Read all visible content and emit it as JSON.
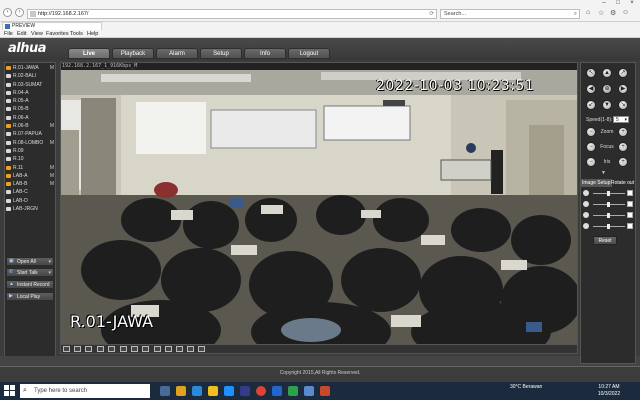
{
  "browser": {
    "url": "http://192.168.2.167/",
    "search_placeholder": "Search...",
    "tab_title": "PREVIEW",
    "menu": [
      "File",
      "Edit",
      "View",
      "Favorites",
      "Tools",
      "Help"
    ]
  },
  "app": {
    "logo": "alhua",
    "nav_tabs": [
      "Live",
      "Playback",
      "Alarm",
      "Setup",
      "Info",
      "Logout"
    ],
    "active_tab": "Live"
  },
  "channels": [
    {
      "label": "R.01-JAWA",
      "active": true,
      "mark": "M"
    },
    {
      "label": "R.02-BALI",
      "active": false,
      "mark": ""
    },
    {
      "label": "R.03-SUMAT",
      "active": false,
      "mark": ""
    },
    {
      "label": "R.04-A",
      "active": false,
      "mark": ""
    },
    {
      "label": "R.05-A",
      "active": false,
      "mark": ""
    },
    {
      "label": "R.05-B",
      "active": false,
      "mark": ""
    },
    {
      "label": "R.06-A",
      "active": false,
      "mark": ""
    },
    {
      "label": "R.06-B",
      "active": true,
      "mark": "M"
    },
    {
      "label": "R.07-PAPUA",
      "active": false,
      "mark": ""
    },
    {
      "label": "R.08-LOMBO",
      "active": false,
      "mark": "M"
    },
    {
      "label": "R.09",
      "active": false,
      "mark": ""
    },
    {
      "label": "R.10",
      "active": false,
      "mark": ""
    },
    {
      "label": "R.11",
      "active": true,
      "mark": "M"
    },
    {
      "label": "LAB-A",
      "active": true,
      "mark": "M"
    },
    {
      "label": "LAB-B",
      "active": true,
      "mark": "M"
    },
    {
      "label": "LAB-C",
      "active": false,
      "mark": ""
    },
    {
      "label": "LAB-D",
      "active": false,
      "mark": ""
    },
    {
      "label": "LAB-JRGN",
      "active": false,
      "mark": ""
    }
  ],
  "controls": {
    "open_all": "Open All",
    "start_talk": "Start Talk",
    "instant_record": "Instant Record",
    "local_play": "Local Play"
  },
  "video": {
    "info": "192.168.2.167_1_916Kbps_M",
    "timestamp": "2022-10-03 10:23:51",
    "camera_name": "R.01-JAWA"
  },
  "ptz": {
    "speed_label": "Speed(1-8):",
    "speed_value": "5",
    "zoom_label": "Zoom",
    "focus_label": "Focus",
    "iris_label": "Iris"
  },
  "image_setup": {
    "tab_image": "Image Setup",
    "tab_rotate": "Rotate out",
    "reset": "Reset"
  },
  "footer": "Copyright 2015,All Rights Reserved.",
  "taskbar": {
    "search": "Type here to search",
    "weather": "30°C  Berawan",
    "time": "10:27 AM",
    "date": "10/3/2022"
  }
}
